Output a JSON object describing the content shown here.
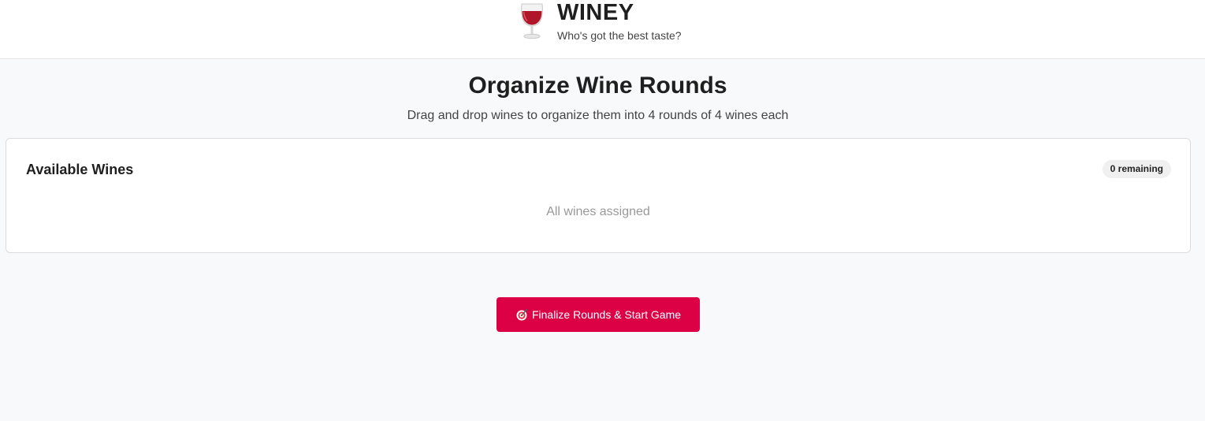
{
  "header": {
    "logo_icon": "wine-glass-icon",
    "title": "WINEY",
    "tagline": "Who's got the best taste?"
  },
  "page": {
    "title": "Organize Wine Rounds",
    "subtitle": "Drag and drop wines to organize them into 4 rounds of 4 wines each"
  },
  "available_wines": {
    "title": "Available Wines",
    "remaining_badge": "0 remaining",
    "empty_message": "All wines assigned"
  },
  "finalize_button": {
    "icon": "target-icon",
    "label": "Finalize Rounds & Start Game"
  },
  "colors": {
    "accent": "#dc0045",
    "wine": "#b0162a",
    "background": "#f8f9fa"
  }
}
